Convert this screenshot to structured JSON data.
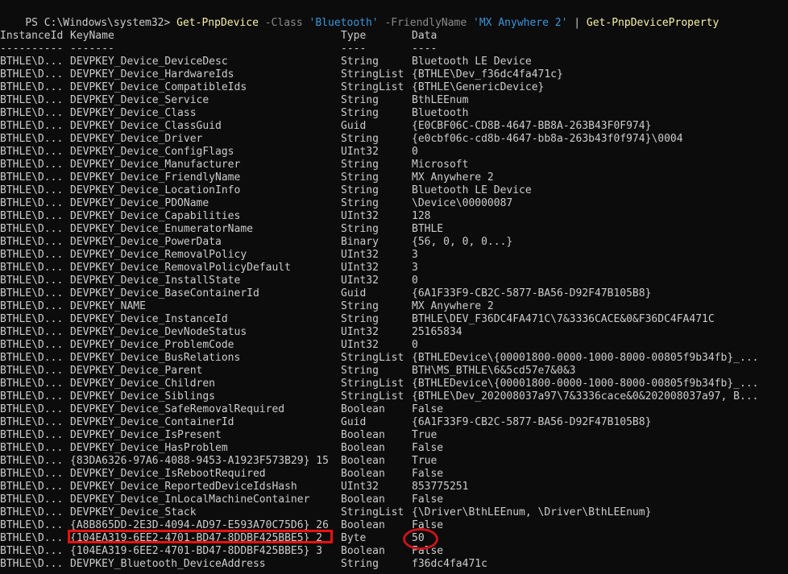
{
  "command": {
    "prompt": "PS C:\\Windows\\system32> ",
    "parts": [
      {
        "text": "Get-PnpDevice",
        "kind": "cmdlet"
      },
      {
        "text": " ",
        "kind": "op"
      },
      {
        "text": "-Class",
        "kind": "param"
      },
      {
        "text": " ",
        "kind": "op"
      },
      {
        "text": "'Bluetooth'",
        "kind": "string"
      },
      {
        "text": " ",
        "kind": "op"
      },
      {
        "text": "-FriendlyName",
        "kind": "param"
      },
      {
        "text": " ",
        "kind": "op"
      },
      {
        "text": "'MX Anywhere 2'",
        "kind": "string"
      },
      {
        "text": " | ",
        "kind": "op"
      },
      {
        "text": "Get-PnpDeviceProperty",
        "kind": "cmdlet"
      }
    ]
  },
  "columns": [
    "InstanceId",
    "KeyName",
    "Type",
    "Data"
  ],
  "separators": [
    "----------",
    "-------",
    "----",
    "----"
  ],
  "rows": [
    [
      "BTHLE\\D...",
      "DEVPKEY_Device_DeviceDesc",
      "String",
      "Bluetooth LE Device"
    ],
    [
      "BTHLE\\D...",
      "DEVPKEY_Device_HardwareIds",
      "StringList",
      "{BTHLE\\Dev_f36dc4fa471c}"
    ],
    [
      "BTHLE\\D...",
      "DEVPKEY_Device_CompatibleIds",
      "StringList",
      "{BTHLE\\GenericDevice}"
    ],
    [
      "BTHLE\\D...",
      "DEVPKEY_Device_Service",
      "String",
      "BthLEEnum"
    ],
    [
      "BTHLE\\D...",
      "DEVPKEY_Device_Class",
      "String",
      "Bluetooth"
    ],
    [
      "BTHLE\\D...",
      "DEVPKEY_Device_ClassGuid",
      "Guid",
      "{E0CBF06C-CD8B-4647-BB8A-263B43F0F974}"
    ],
    [
      "BTHLE\\D...",
      "DEVPKEY_Device_Driver",
      "String",
      "{e0cbf06c-cd8b-4647-bb8a-263b43f0f974}\\0004"
    ],
    [
      "BTHLE\\D...",
      "DEVPKEY_Device_ConfigFlags",
      "UInt32",
      "0"
    ],
    [
      "BTHLE\\D...",
      "DEVPKEY_Device_Manufacturer",
      "String",
      "Microsoft"
    ],
    [
      "BTHLE\\D...",
      "DEVPKEY_Device_FriendlyName",
      "String",
      "MX Anywhere 2"
    ],
    [
      "BTHLE\\D...",
      "DEVPKEY_Device_LocationInfo",
      "String",
      "Bluetooth LE Device"
    ],
    [
      "BTHLE\\D...",
      "DEVPKEY_Device_PDOName",
      "String",
      "\\Device\\00000087"
    ],
    [
      "BTHLE\\D...",
      "DEVPKEY_Device_Capabilities",
      "UInt32",
      "128"
    ],
    [
      "BTHLE\\D...",
      "DEVPKEY_Device_EnumeratorName",
      "String",
      "BTHLE"
    ],
    [
      "BTHLE\\D...",
      "DEVPKEY_Device_PowerData",
      "Binary",
      "{56, 0, 0, 0...}"
    ],
    [
      "BTHLE\\D...",
      "DEVPKEY_Device_RemovalPolicy",
      "UInt32",
      "3"
    ],
    [
      "BTHLE\\D...",
      "DEVPKEY_Device_RemovalPolicyDefault",
      "UInt32",
      "3"
    ],
    [
      "BTHLE\\D...",
      "DEVPKEY_Device_InstallState",
      "UInt32",
      "0"
    ],
    [
      "BTHLE\\D...",
      "DEVPKEY_Device_BaseContainerId",
      "Guid",
      "{6A1F33F9-CB2C-5877-BA56-D92F47B105B8}"
    ],
    [
      "BTHLE\\D...",
      "DEVPKEY_NAME",
      "String",
      "MX Anywhere 2"
    ],
    [
      "BTHLE\\D...",
      "DEVPKEY_Device_InstanceId",
      "String",
      "BTHLE\\DEV_F36DC4FA471C\\7&3336CACE&0&F36DC4FA471C"
    ],
    [
      "BTHLE\\D...",
      "DEVPKEY_Device_DevNodeStatus",
      "UInt32",
      "25165834"
    ],
    [
      "BTHLE\\D...",
      "DEVPKEY_Device_ProblemCode",
      "UInt32",
      "0"
    ],
    [
      "BTHLE\\D...",
      "DEVPKEY_Device_BusRelations",
      "StringList",
      "{BTHLEDevice\\{00001800-0000-1000-8000-00805f9b34fb}_..."
    ],
    [
      "BTHLE\\D...",
      "DEVPKEY_Device_Parent",
      "String",
      "BTH\\MS_BTHLE\\6&5cd57e7&0&3"
    ],
    [
      "BTHLE\\D...",
      "DEVPKEY_Device_Children",
      "StringList",
      "{BTHLEDevice\\{00001800-0000-1000-8000-00805f9b34fb}_..."
    ],
    [
      "BTHLE\\D...",
      "DEVPKEY_Device_Siblings",
      "StringList",
      "{BTHLE\\Dev_202008037a97\\7&3336cace&0&202008037a97, B..."
    ],
    [
      "BTHLE\\D...",
      "DEVPKEY_Device_SafeRemovalRequired",
      "Boolean",
      "False"
    ],
    [
      "BTHLE\\D...",
      "DEVPKEY_Device_ContainerId",
      "Guid",
      "{6A1F33F9-CB2C-5877-BA56-D92F47B105B8}"
    ],
    [
      "BTHLE\\D...",
      "DEVPKEY_Device_IsPresent",
      "Boolean",
      "True"
    ],
    [
      "BTHLE\\D...",
      "DEVPKEY_Device_HasProblem",
      "Boolean",
      "False"
    ],
    [
      "BTHLE\\D...",
      "{83DA6326-97A6-4088-9453-A1923F573B29} 15",
      "Boolean",
      "True"
    ],
    [
      "BTHLE\\D...",
      "DEVPKEY_Device_IsRebootRequired",
      "Boolean",
      "False"
    ],
    [
      "BTHLE\\D...",
      "DEVPKEY_Device_ReportedDeviceIdsHash",
      "UInt32",
      "853775251"
    ],
    [
      "BTHLE\\D...",
      "DEVPKEY_Device_InLocalMachineContainer",
      "Boolean",
      "False"
    ],
    [
      "BTHLE\\D...",
      "DEVPKEY_Device_Stack",
      "StringList",
      "{\\Driver\\BthLEEnum, \\Driver\\BthLEEnum}"
    ],
    [
      "BTHLE\\D...",
      "{A8B865DD-2E3D-4094-AD97-E593A70C75D6} 26",
      "Boolean",
      "False"
    ],
    [
      "BTHLE\\D...",
      "{104EA319-6EE2-4701-BD47-8DDBF425BBE5} 2",
      "Byte",
      "50"
    ],
    [
      "BTHLE\\D...",
      "{104EA319-6EE2-4701-BD47-8DDBF425BBE5} 3",
      "Boolean",
      "False"
    ],
    [
      "BTHLE\\D...",
      "DEVPKEY_Bluetooth_DeviceAddress",
      "String",
      "f36dc4fa471c"
    ]
  ],
  "colors": {
    "background": "#0c0c0c",
    "text": "#cccccc",
    "cmdlet": "#f9f1a5",
    "parameter": "#8a8a8a",
    "string": "#3a96dd",
    "highlight_rect": "#e8110f",
    "highlight_ellipse": "#c8141a"
  }
}
